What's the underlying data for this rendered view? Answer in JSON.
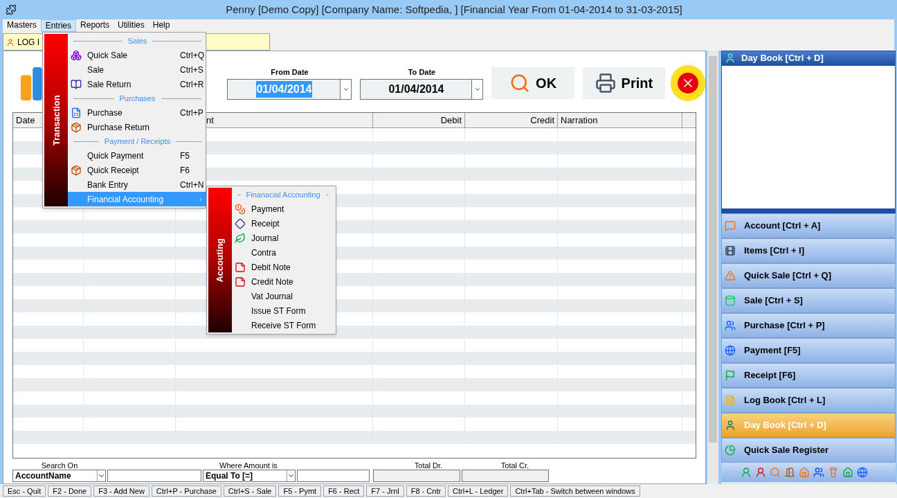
{
  "window": {
    "title": "Penny [Demo Copy] [Company Name: Softpedia, ] [Financial Year From 01-04-2014 to 31-03-2015]"
  },
  "menu_bar": [
    {
      "label": "Masters",
      "selected": false
    },
    {
      "label": "Entries",
      "selected": true
    },
    {
      "label": "Reports",
      "selected": false
    },
    {
      "label": "Utilities",
      "selected": false
    },
    {
      "label": "Help",
      "selected": false
    }
  ],
  "tabs": [
    {
      "label": "LOG I",
      "selected": true
    }
  ],
  "entries_menu": {
    "band_label": "Transaction",
    "sections": [
      {
        "heading": "Sales",
        "items": [
          {
            "label": "Quick Sale",
            "shortcut": "Ctrl+Q",
            "selected": false
          },
          {
            "label": "Sale",
            "shortcut": "Ctrl+S",
            "selected": false
          },
          {
            "label": "Sale Return",
            "shortcut": "Ctrl+R",
            "selected": false
          }
        ]
      },
      {
        "heading": "Purchases",
        "items": [
          {
            "label": "Purchase",
            "shortcut": "Ctrl+P",
            "selected": false
          },
          {
            "label": "Purchase Return",
            "selected": false
          }
        ]
      },
      {
        "heading": "Payment / Receipts",
        "items": [
          {
            "label": "Quick Payment",
            "shortcut": "F5",
            "selected": false
          },
          {
            "label": "Quick Receipt",
            "shortcut": "F6",
            "selected": false
          },
          {
            "label": "Bank Entry",
            "shortcut": "Ctrl+N",
            "selected": false
          },
          {
            "label": "Financial Accounting",
            "submenu": true,
            "selected": true
          }
        ]
      }
    ]
  },
  "submenu": {
    "band_label": "Accouting",
    "heading": "Finanacial Accounting",
    "items": [
      {
        "label": "Payment"
      },
      {
        "label": "Receipt"
      },
      {
        "label": "Journal"
      },
      {
        "label": "Contra"
      },
      {
        "label": "Debit Note"
      },
      {
        "label": "Credit Note"
      },
      {
        "label": "Vat Journal"
      },
      {
        "label": "Issue ST Form"
      },
      {
        "label": "Receive ST Form"
      }
    ]
  },
  "filters": {
    "from_date": {
      "label": "From Date",
      "value": "01/04/2014",
      "selected": true
    },
    "to_date": {
      "label": "To Date",
      "value": "01/04/2014",
      "selected": false
    },
    "buttons": [
      {
        "label": "OK",
        "kind": "search"
      },
      {
        "label": "Print",
        "kind": "print"
      }
    ]
  },
  "grid": {
    "columns": [
      {
        "label": "Date"
      },
      {},
      {
        "label": "nt"
      },
      {
        "label": "Debit"
      },
      {
        "label": "Credit"
      },
      {
        "label": "Narration"
      }
    ]
  },
  "search": {
    "search_on": {
      "label": "Search On",
      "value": "AccountName"
    },
    "where_amount": {
      "label": "Where Amount is",
      "value": "Equal To [=]"
    },
    "total_dr": {
      "label": "Total Dr."
    },
    "total_cr": {
      "label": "Total Cr."
    }
  },
  "side_panel": {
    "header": "Day Book [Ctrl + D]",
    "items": [
      {
        "label": "Account [Ctrl + A]",
        "selected": false
      },
      {
        "label": "Items [Ctrl + I]",
        "selected": false
      },
      {
        "label": "Quick Sale [Ctrl + Q]",
        "selected": false
      },
      {
        "label": "Sale [Ctrl + S]",
        "selected": false
      },
      {
        "label": "Purchase [Ctrl + P]",
        "selected": false
      },
      {
        "label": "Payment [F5]",
        "selected": false
      },
      {
        "label": "Receipt [F6]",
        "selected": false
      },
      {
        "label": "Log Book [Ctrl + L]",
        "selected": false
      },
      {
        "label": "Day Book [Ctrl + D]",
        "selected": true
      },
      {
        "label": "Quick Sale Register",
        "selected": false
      }
    ]
  },
  "status_bar": [
    "Esc - Quit",
    "F2 - Done",
    "F3 - Add New",
    "Ctrl+P - Purchase",
    "Ctrl+S - Sale",
    "F5 - Pymt",
    "F6 - Rect",
    "F7 - Jrnl",
    "F8 - Cntr",
    "Ctrl+L - Ledger",
    "Ctrl+Tab - Switch between windows"
  ]
}
